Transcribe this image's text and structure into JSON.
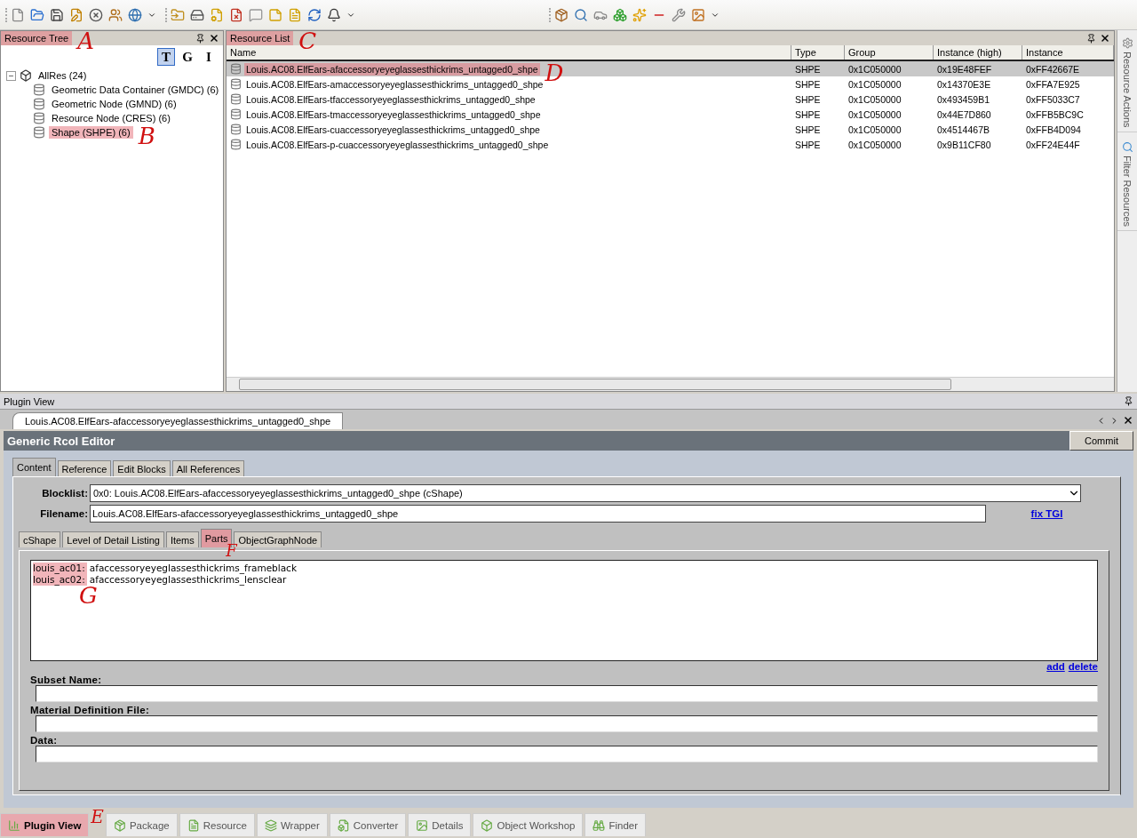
{
  "resource_tree": {
    "title": "Resource Tree",
    "annotation": "A",
    "view_buttons": [
      {
        "label": "T",
        "selected": true
      },
      {
        "label": "G",
        "selected": false
      },
      {
        "label": "I",
        "selected": false
      }
    ],
    "tree": [
      {
        "label": "AllRes (24)",
        "expanded": true,
        "children": [
          {
            "label": "Geometric Data Container (GMDC) (6)"
          },
          {
            "label": "Geometric Node (GMND) (6)"
          },
          {
            "label": "Resource Node (CRES) (6)"
          },
          {
            "label": "Shape (SHPE) (6)",
            "annotation": "B"
          }
        ]
      }
    ]
  },
  "resource_list": {
    "title": "Resource List",
    "annotation": "C",
    "columns": [
      "Name",
      "Type",
      "Group",
      "Instance (high)",
      "Instance"
    ],
    "rows": [
      {
        "cells": [
          "Louis.AC08.ElfEars-afaccessoryeyeglassesthickrims_untagged0_shpe",
          "SHPE",
          "0x1C050000",
          "0x19E48FEF",
          "0xFF42667E"
        ],
        "selected": true,
        "annotation": "D"
      },
      {
        "cells": [
          "Louis.AC08.ElfEars-amaccessoryeyeglassesthickrims_untagged0_shpe",
          "SHPE",
          "0x1C050000",
          "0x14370E3E",
          "0xFFA7E925"
        ],
        "selected": false
      },
      {
        "cells": [
          "Louis.AC08.ElfEars-tfaccessoryeyeglassesthickrims_untagged0_shpe",
          "SHPE",
          "0x1C050000",
          "0x493459B1",
          "0xFF5033C7"
        ],
        "selected": false
      },
      {
        "cells": [
          "Louis.AC08.ElfEars-tmaccessoryeyeglassesthickrims_untagged0_shpe",
          "SHPE",
          "0x1C050000",
          "0x44E7D860",
          "0xFFB5BC9C"
        ],
        "selected": false
      },
      {
        "cells": [
          "Louis.AC08.ElfEars-cuaccessoryeyeglassesthickrims_untagged0_shpe",
          "SHPE",
          "0x1C050000",
          "0x4514467B",
          "0xFFB4D094"
        ],
        "selected": false
      },
      {
        "cells": [
          "Louis.AC08.ElfEars-p-cuaccessoryeyeglassesthickrims_untagged0_shpe",
          "SHPE",
          "0x1C050000",
          "0x9B11CF80",
          "0xFF24E44F"
        ],
        "selected": false
      }
    ]
  },
  "side_tabs": [
    "Resource Actions",
    "Filter Resources"
  ],
  "plugin_view": {
    "title": "Plugin View",
    "document_tab": "Louis.AC08.ElfEars-afaccessoryeyeglassesthickrims_untagged0_shpe",
    "editor_title": "Generic Rcol Editor",
    "commit_button": "Commit",
    "tabs": [
      {
        "label": "Content",
        "selected": true
      },
      {
        "label": "Reference",
        "selected": false
      },
      {
        "label": "Edit Blocks",
        "selected": false
      },
      {
        "label": "All References",
        "selected": false
      }
    ],
    "blocklist": {
      "label": "Blocklist:",
      "value": "0x0: Louis.AC08.ElfEars-afaccessoryeyeglassesthickrims_untagged0_shpe (cShape)"
    },
    "filename": {
      "label": "Filename:",
      "value": "Louis.AC08.ElfEars-afaccessoryeyeglassesthickrims_untagged0_shpe"
    },
    "fix_link": "fix TGI",
    "subtabs": [
      {
        "label": "cShape",
        "selected": false
      },
      {
        "label": "Level of Detail Listing",
        "selected": false
      },
      {
        "label": "Items",
        "selected": false
      },
      {
        "label": "Parts",
        "selected": true,
        "annotation": "F"
      },
      {
        "label": "ObjectGraphNode",
        "selected": false
      }
    ],
    "parts": {
      "annotation": "G",
      "items": [
        {
          "key": "louis_ac01:",
          "value": "afaccessoryeyeglassesthickrims_frameblack"
        },
        {
          "key": "louis_ac02:",
          "value": "afaccessoryeyeglassesthickrims_lensclear"
        }
      ]
    },
    "links": [
      "add",
      "delete"
    ],
    "fields": [
      {
        "label": "Subset Name:"
      },
      {
        "label": "Material Definition File:"
      },
      {
        "label": "Data:"
      }
    ]
  },
  "bottom_tabs": [
    {
      "label": "Plugin View",
      "selected": true,
      "annotation": "E"
    },
    {
      "label": "Package",
      "selected": false
    },
    {
      "label": "Resource",
      "selected": false
    },
    {
      "label": "Wrapper",
      "selected": false
    },
    {
      "label": "Converter",
      "selected": false
    },
    {
      "label": "Details",
      "selected": false
    },
    {
      "label": "Object Workshop",
      "selected": false
    },
    {
      "label": "Finder",
      "selected": false
    }
  ]
}
